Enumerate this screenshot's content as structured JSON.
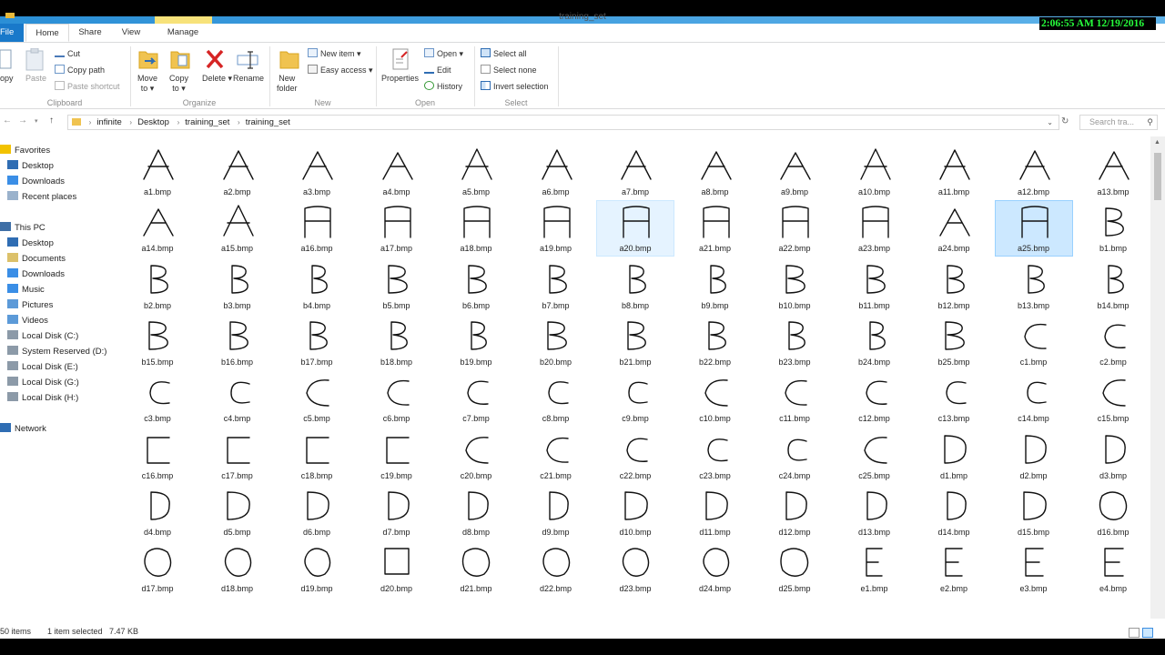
{
  "window": {
    "title": "training_set"
  },
  "clock": "2:06:55 AM 12/19/2016",
  "tabs": [
    {
      "label": "File",
      "kind": "file"
    },
    {
      "label": "Home",
      "kind": "active"
    },
    {
      "label": "Share",
      "kind": ""
    },
    {
      "label": "View",
      "kind": ""
    },
    {
      "label": "Manage",
      "kind": ""
    }
  ],
  "ribbon": {
    "clipboard": {
      "copy": "opy",
      "paste": "Paste",
      "cut": "Cut",
      "copy_path": "Copy path",
      "paste_shortcut": "Paste shortcut",
      "label": "Clipboard"
    },
    "organize": {
      "move_to": "Move",
      "move_to_2": "to",
      "copy_to": "Copy",
      "copy_to_2": "to",
      "delete": "Delete",
      "rename": "Rename",
      "label": "Organize"
    },
    "new": {
      "new_folder": "New",
      "new_folder_2": "folder",
      "new_item": "New item",
      "easy_access": "Easy access",
      "label": "New"
    },
    "open": {
      "properties": "Properties",
      "open": "Open",
      "edit": "Edit",
      "history": "History",
      "label": "Open"
    },
    "select": {
      "select_all": "Select all",
      "select_none": "Select none",
      "invert": "Invert selection",
      "label": "Select"
    }
  },
  "breadcrumb": [
    "infinite",
    "Desktop",
    "training_set",
    "training_set"
  ],
  "search_placeholder": "Search tra...",
  "nav": {
    "favorites": "Favorites",
    "fav_items": [
      "Desktop",
      "Downloads",
      "Recent places"
    ],
    "this_pc": "This PC",
    "pc_items": [
      "Desktop",
      "Documents",
      "Downloads",
      "Music",
      "Pictures",
      "Videos",
      "Local Disk (C:)",
      "System Reserved (D:)",
      "Local Disk (E:)",
      "Local Disk (G:)",
      "Local Disk (H:)"
    ],
    "network": "Network"
  },
  "files": [
    "a1.bmp",
    "a2.bmp",
    "a3.bmp",
    "a4.bmp",
    "a5.bmp",
    "a6.bmp",
    "a7.bmp",
    "a8.bmp",
    "a9.bmp",
    "a10.bmp",
    "a11.bmp",
    "a12.bmp",
    "a13.bmp",
    "a14.bmp",
    "a15.bmp",
    "a16.bmp",
    "a17.bmp",
    "a18.bmp",
    "a19.bmp",
    "a20.bmp",
    "a21.bmp",
    "a22.bmp",
    "a23.bmp",
    "a24.bmp",
    "a25.bmp",
    "b1.bmp",
    "b2.bmp",
    "b3.bmp",
    "b4.bmp",
    "b5.bmp",
    "b6.bmp",
    "b7.bmp",
    "b8.bmp",
    "b9.bmp",
    "b10.bmp",
    "b11.bmp",
    "b12.bmp",
    "b13.bmp",
    "b14.bmp",
    "b15.bmp",
    "b16.bmp",
    "b17.bmp",
    "b18.bmp",
    "b19.bmp",
    "b20.bmp",
    "b21.bmp",
    "b22.bmp",
    "b23.bmp",
    "b24.bmp",
    "b25.bmp",
    "c1.bmp",
    "c2.bmp",
    "c3.bmp",
    "c4.bmp",
    "c5.bmp",
    "c6.bmp",
    "c7.bmp",
    "c8.bmp",
    "c9.bmp",
    "c10.bmp",
    "c11.bmp",
    "c12.bmp",
    "c13.bmp",
    "c14.bmp",
    "c15.bmp",
    "c16.bmp",
    "c17.bmp",
    "c18.bmp",
    "c19.bmp",
    "c20.bmp",
    "c21.bmp",
    "c22.bmp",
    "c23.bmp",
    "c24.bmp",
    "c25.bmp",
    "d1.bmp",
    "d2.bmp",
    "d3.bmp",
    "d4.bmp",
    "d5.bmp",
    "d6.bmp",
    "d7.bmp",
    "d8.bmp",
    "d9.bmp",
    "d10.bmp",
    "d11.bmp",
    "d12.bmp",
    "d13.bmp",
    "d14.bmp",
    "d15.bmp",
    "d16.bmp",
    "d17.bmp",
    "d18.bmp",
    "d19.bmp",
    "d20.bmp",
    "d21.bmp",
    "d22.bmp",
    "d23.bmp",
    "d24.bmp",
    "d25.bmp",
    "e1.bmp",
    "e2.bmp",
    "e3.bmp",
    "e4.bmp"
  ],
  "selected_file": "a25.bmp",
  "hovered_file": "a20.bmp",
  "status": {
    "items": "50 items",
    "selected": "1 item selected",
    "size": "7.47 KB"
  },
  "colors": {
    "file_tab": "#1979ca",
    "selection": "#cce8ff",
    "clock_text": "#27ff3c"
  }
}
